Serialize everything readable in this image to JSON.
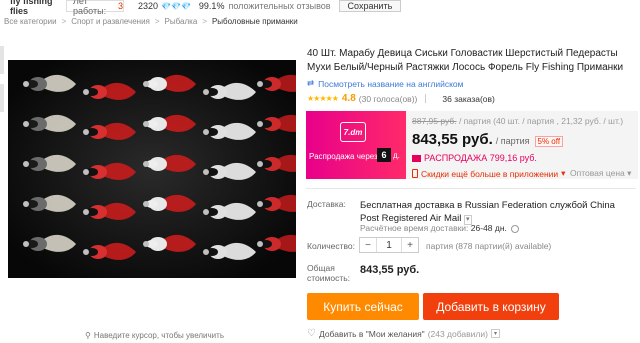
{
  "topbar": {
    "store_name": "fly fishing flies",
    "years_label": "Лет работы:",
    "years_value": "3",
    "score": "2320",
    "diamonds": "💎💎💎",
    "positive_pct": "99.1%",
    "feedback_label": "положительных отзывов",
    "save_label": "Сохранить"
  },
  "breadcrumb": [
    "Все категории",
    "Спорт и развлечения",
    "Рыбалка",
    "Рыболовные приманки"
  ],
  "gallery": {
    "zoom_hint": "Наведите курсор, чтобы увеличить"
  },
  "product": {
    "title": "40 Шт. Марабу Девица Сиськи Головастик Шерстистый Педерасты Мухи Белый/Черный Растяжки Лосось Форель Fly Fishing Приманки",
    "translate_link": "Посмотреть название на английском",
    "stars": "★★★★★",
    "rating": "4.8",
    "votes": "(30 голоса(ов))",
    "orders": "36 заказа(ов)"
  },
  "promo": {
    "logo_text": "7.dm",
    "ends_label": "Распродажа через",
    "countdown": "6",
    "countdown_unit": "д."
  },
  "price": {
    "old_price": "887,95 руб.",
    "old_suffix": "/ партия (40 шт. / партия , 21,32 руб. / шт.)",
    "current": "843,55 руб.",
    "unit": "/ партия",
    "discount": "5% off",
    "sale_label": "РАСПРОДАЖА 799,16 руб.",
    "app_discount": "Скидки ещё больше в приложении",
    "wholesale": "Оптовая цена"
  },
  "delivery": {
    "label": "Доставка:",
    "text": "Бесплатная доставка в Russian Federation службой China Post Registered Air Mail",
    "eta_label": "Расчётное время доставки:",
    "eta_value": "26-48 дн."
  },
  "quantity": {
    "label": "Количество:",
    "minus": "−",
    "value": "1",
    "plus": "+",
    "available": "партия (878 партии(й) available)"
  },
  "total": {
    "label_line1": "Общая",
    "label_line2": "стоимость:",
    "value": "843,55 руб."
  },
  "actions": {
    "buy_now": "Купить сейчас",
    "add_to_cart": "Добавить в корзину"
  },
  "wishlist": {
    "label": "Добавить в \"Мои желания\"",
    "count": "(243 добавили)"
  },
  "colors": {
    "accent_orange": "#ff8a00",
    "accent_red": "#f1400e",
    "promo_pink": "#e8008a",
    "price_red": "#e62e04",
    "link_blue": "#3d7ad7",
    "star_gold": "#ffb800"
  }
}
